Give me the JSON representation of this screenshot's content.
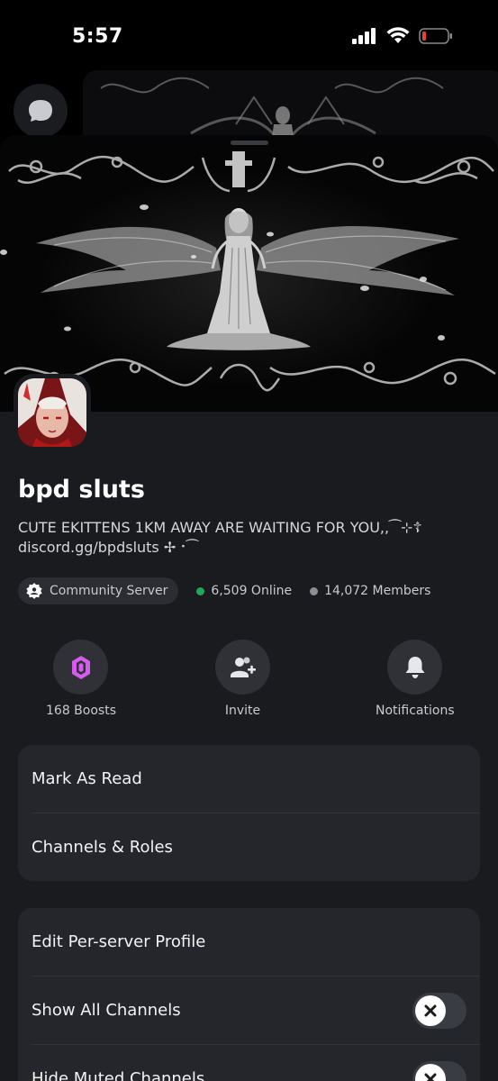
{
  "status_bar": {
    "time": "5:57"
  },
  "server": {
    "name": "bpd sluts",
    "description_line1": "CUTE EKITTENS 1KM AWAY ARE WAITING FOR YOU,,⁀⊹☦",
    "description_line2": "discord.gg/bpdsluts ✢⠐⁀",
    "community_label": "Community Server",
    "online_text": "6,509 Online",
    "members_text": "14,072 Members"
  },
  "actions": {
    "boosts_label": "168 Boosts",
    "invite_label": "Invite",
    "notifications_label": "Notifications"
  },
  "menu1": {
    "mark_as_read": "Mark As Read",
    "channels_roles": "Channels & Roles"
  },
  "menu2": {
    "edit_profile": "Edit Per-server Profile",
    "show_all_channels": "Show All Channels",
    "hide_muted_channels": "Hide Muted Channels"
  },
  "colors": {
    "sheet_bg": "#1a1b1f",
    "card_bg": "#25262b",
    "online_dot": "#23a55a",
    "members_dot": "#8d8f96",
    "boost_pink": "#d65cf0",
    "battery_red": "#e5403a"
  }
}
